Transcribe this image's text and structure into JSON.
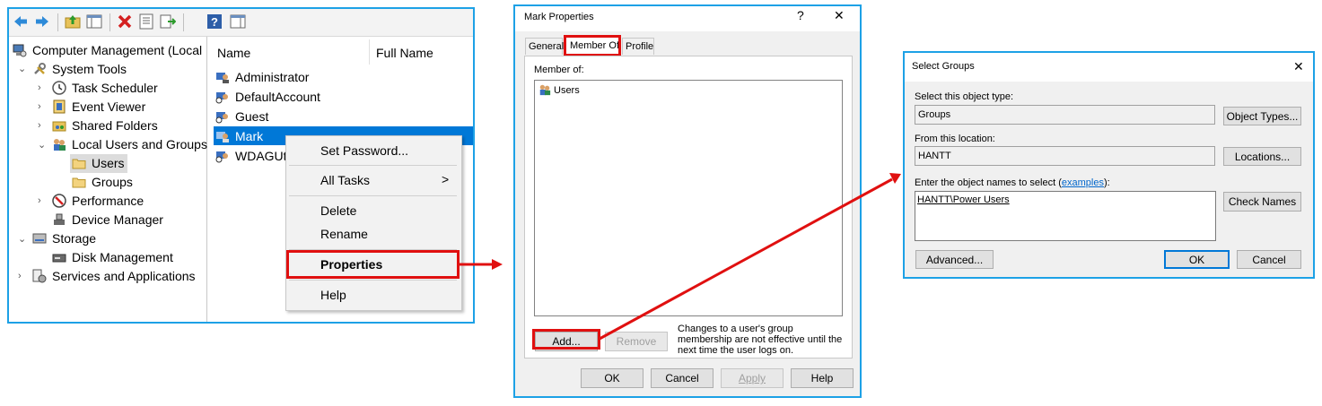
{
  "mmc": {
    "toolbar_icons": [
      "back-arrow-icon",
      "forward-arrow-icon",
      "up-folder-icon",
      "show-hide-tree-icon",
      "delete-icon",
      "properties-icon",
      "export-list-icon",
      "help-icon",
      "action-pane-icon"
    ],
    "tree": [
      {
        "label": "Computer Management (Local",
        "chev": ""
      },
      {
        "label": "System Tools",
        "chev": "v"
      },
      {
        "label": "Task Scheduler",
        "chev": ">"
      },
      {
        "label": "Event Viewer",
        "chev": ">"
      },
      {
        "label": "Shared Folders",
        "chev": ">"
      },
      {
        "label": "Local Users and Groups",
        "chev": "v"
      },
      {
        "label": "Users",
        "chev": ""
      },
      {
        "label": "Groups",
        "chev": ""
      },
      {
        "label": "Performance",
        "chev": ">"
      },
      {
        "label": "Device Manager",
        "chev": ""
      },
      {
        "label": "Storage",
        "chev": "v"
      },
      {
        "label": "Disk Management",
        "chev": ""
      },
      {
        "label": "Services and Applications",
        "chev": ">"
      }
    ],
    "columns": [
      "Name",
      "Full Name"
    ],
    "users": [
      "Administrator",
      "DefaultAccount",
      "Guest",
      "Mark",
      "WDAGUti"
    ],
    "context_menu": [
      "Set Password...",
      "All Tasks",
      "Delete",
      "Rename",
      "Properties",
      "Help"
    ],
    "submenu_arrow": ">"
  },
  "props": {
    "title": "Mark Properties",
    "help_glyph": "?",
    "close_glyph": "✕",
    "tabs": [
      "General",
      "Member Of",
      "Profile"
    ],
    "member_of_label": "Member of:",
    "members": [
      "Users"
    ],
    "add_label": "Add...",
    "remove_label": "Remove",
    "note": "Changes to a user's group membership are not effective until the next time the user logs on.",
    "buttons": [
      "OK",
      "Cancel",
      "Apply",
      "Help"
    ]
  },
  "select": {
    "title": "Select Groups",
    "close_glyph": "✕",
    "object_type_label": "Select this object type:",
    "object_type_value": "Groups",
    "object_types_button": "Object Types...",
    "location_label": "From this location:",
    "location_value": "HANTT",
    "locations_button": "Locations...",
    "names_label_prefix": "Enter the object names to select (",
    "names_label_link": "examples",
    "names_label_suffix": "):",
    "names_value": "HANTT\\Power Users",
    "check_names_button": "Check Names",
    "advanced_button": "Advanced...",
    "ok_button": "OK",
    "cancel_button": "Cancel"
  },
  "colors": {
    "highlight_frame": "#1da1e6",
    "callout_red": "#e01010",
    "selection": "#0078d7"
  }
}
